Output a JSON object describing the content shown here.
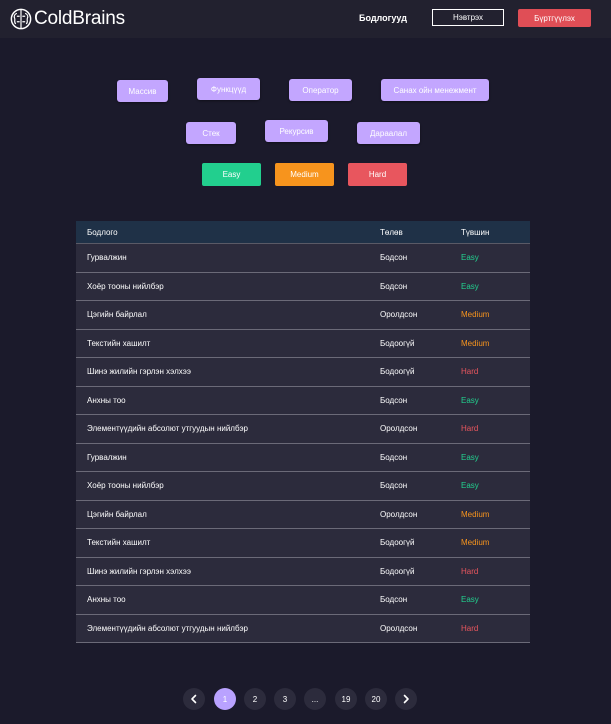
{
  "brand": {
    "name": "ColdBrains"
  },
  "header": {
    "nav_problems": "Бодлогууд",
    "login": "Нэвтрэх",
    "signup": "Бүртгүүлэх"
  },
  "topics": [
    "Массив",
    "Функцүүд",
    "Оператор",
    "Санах ойн менежмент",
    "Стек",
    "Рекурсив",
    "Дараалал"
  ],
  "difficulty_filters": [
    "Easy",
    "Medium",
    "Hard"
  ],
  "colors": {
    "easy": "#22cf8e",
    "medium": "#f7941d",
    "hard": "#e8565e",
    "tag": "#c3a6ff",
    "accent": "#e04e56"
  },
  "table": {
    "headers": {
      "problem": "Бодлого",
      "status": "Төлөв",
      "level": "Түвшин"
    },
    "rows": [
      {
        "problem": "Гурвалжин",
        "status": "Бодсон",
        "level": "Easy"
      },
      {
        "problem": "Хоёр тооны нийлбэр",
        "status": "Бодсон",
        "level": "Easy"
      },
      {
        "problem": "Цэгийн байрлал",
        "status": "Оролдсон",
        "level": "Medium"
      },
      {
        "problem": "Текстийн хашилт",
        "status": "Бодоогүй",
        "level": "Medium"
      },
      {
        "problem": "Шинэ жилийн гэрлэн хэлхээ",
        "status": "Бодоогүй",
        "level": "Hard"
      },
      {
        "problem": "Анхны тоо",
        "status": "Бодсон",
        "level": "Easy"
      },
      {
        "problem": "Элементүүдийн абсолют утгуудын нийлбэр",
        "status": "Оролдсон",
        "level": "Hard"
      },
      {
        "problem": "Гурвалжин",
        "status": "Бодсон",
        "level": "Easy"
      },
      {
        "problem": "Хоёр тооны нийлбэр",
        "status": "Бодсон",
        "level": "Easy"
      },
      {
        "problem": "Цэгийн байрлал",
        "status": "Оролдсон",
        "level": "Medium"
      },
      {
        "problem": "Текстийн хашилт",
        "status": "Бодоогүй",
        "level": "Medium"
      },
      {
        "problem": "Шинэ жилийн гэрлэн хэлхээ",
        "status": "Бодоогүй",
        "level": "Hard"
      },
      {
        "problem": "Анхны тоо",
        "status": "Бодсон",
        "level": "Easy"
      },
      {
        "problem": "Элементүүдийн абсолют утгуудын нийлбэр",
        "status": "Оролдсон",
        "level": "Hard"
      }
    ]
  },
  "pagination": {
    "prev_icon": "chevron-left-icon",
    "next_icon": "chevron-right-icon",
    "pages": [
      "1",
      "2",
      "3",
      "...",
      "19",
      "20"
    ],
    "current": "1"
  }
}
